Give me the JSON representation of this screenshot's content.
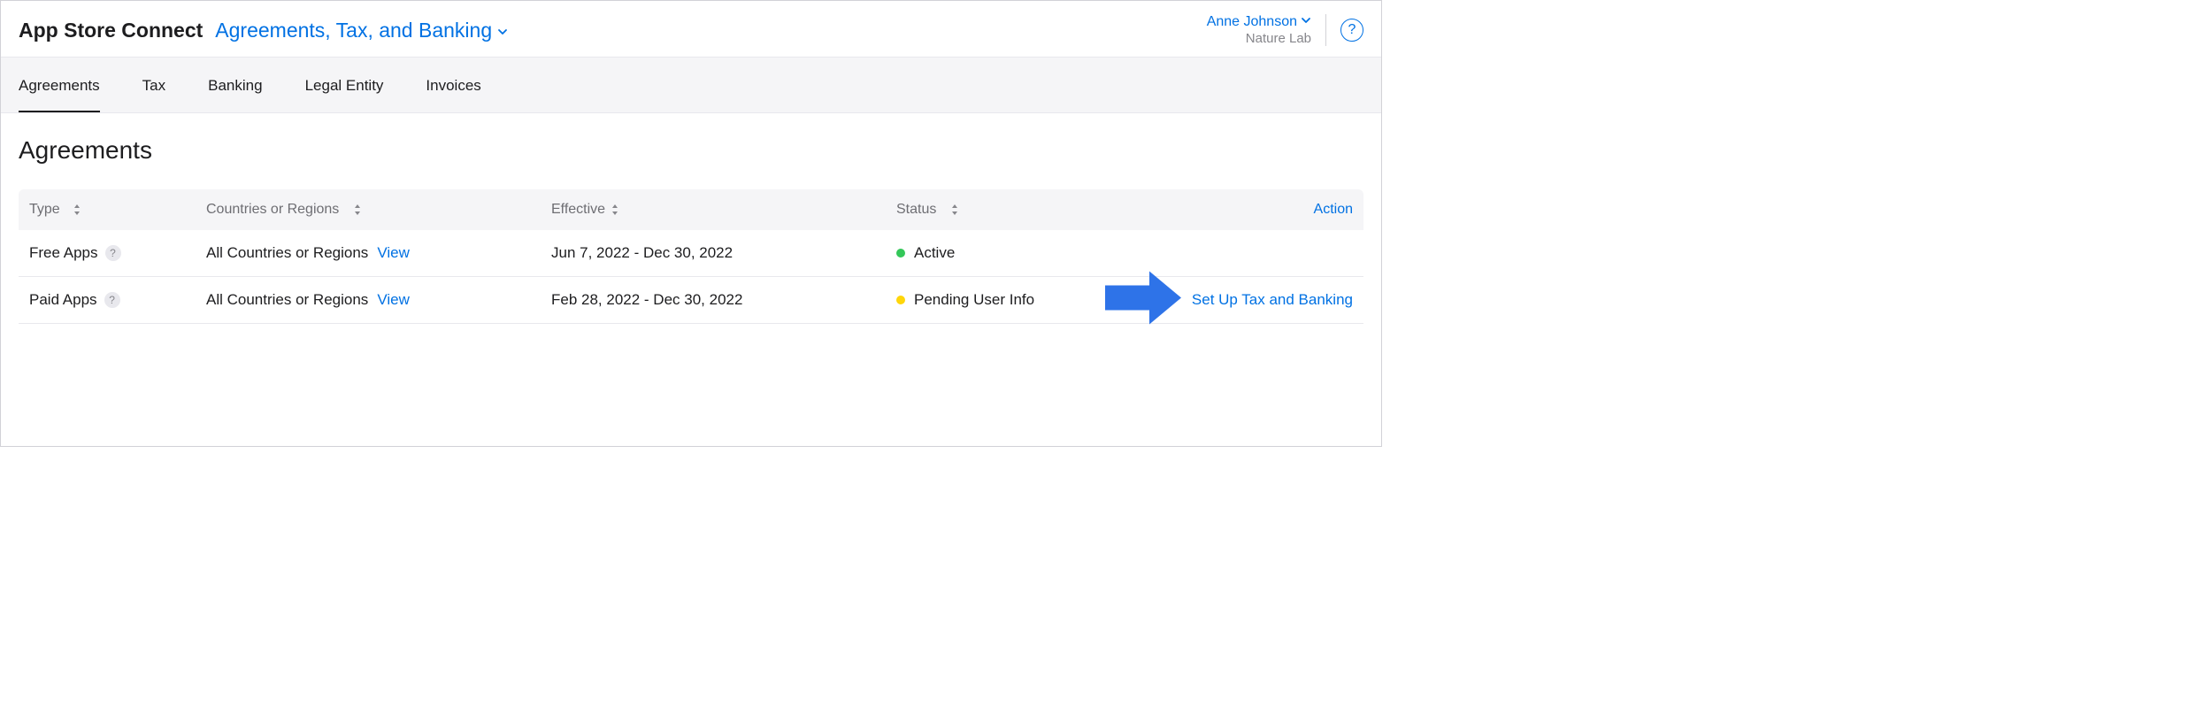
{
  "header": {
    "app_title": "App Store Connect",
    "section_label": "Agreements, Tax, and Banking",
    "user_name": "Anne Johnson",
    "user_org": "Nature Lab"
  },
  "tabs": [
    {
      "label": "Agreements",
      "active": true
    },
    {
      "label": "Tax",
      "active": false
    },
    {
      "label": "Banking",
      "active": false
    },
    {
      "label": "Legal Entity",
      "active": false
    },
    {
      "label": "Invoices",
      "active": false
    }
  ],
  "page": {
    "heading": "Agreements"
  },
  "table": {
    "columns": {
      "type": "Type",
      "countries": "Countries or Regions",
      "effective": "Effective",
      "status": "Status",
      "action": "Action"
    },
    "rows": [
      {
        "type": "Free Apps",
        "countries": "All Countries or Regions",
        "view_label": "View",
        "effective": "Jun 7, 2022 - Dec 30, 2022",
        "status": "Active",
        "status_color": "green",
        "action": ""
      },
      {
        "type": "Paid Apps",
        "countries": "All Countries or Regions",
        "view_label": "View",
        "effective": "Feb 28, 2022 - Dec 30, 2022",
        "status": "Pending User Info",
        "status_color": "yellow",
        "action": "Set Up Tax and Banking"
      }
    ]
  }
}
